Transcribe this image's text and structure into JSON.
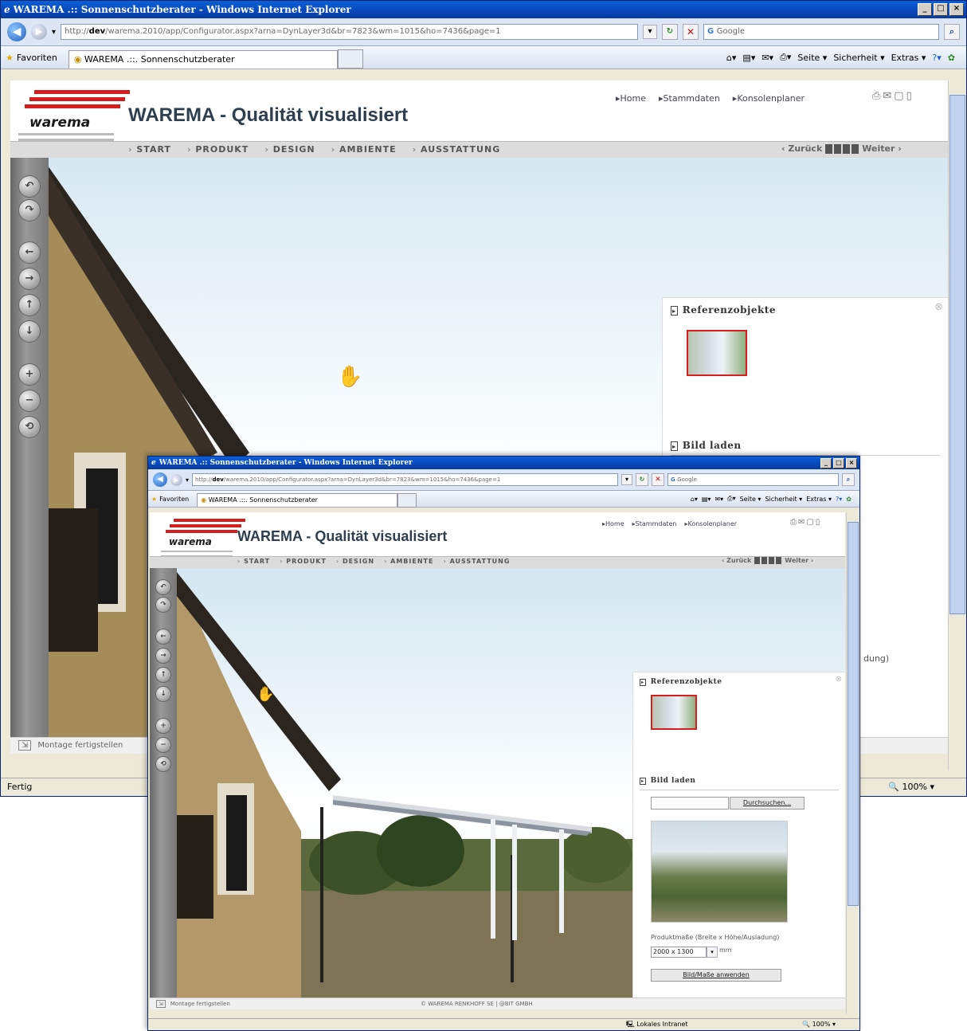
{
  "browser": {
    "title": "WAREMA .:: Sonnenschutzberater - Windows Internet Explorer",
    "url_prefix": "http://",
    "url_host": "dev",
    "url_rest": "/warema.2010/app/Configurator.aspx?arna=DynLayer3d&br=7823&wm=1015&ho=7436&page=1",
    "search_placeholder": "Google",
    "favorites_label": "Favoriten",
    "tab_label": "WAREMA .::. Sonnenschutzberater",
    "cmd_seite": "Seite ▾",
    "cmd_sicherheit": "Sicherheit ▾",
    "cmd_extras": "Extras ▾",
    "status_text": "Fertig",
    "status_zone": "Lokales Intranet",
    "zoom": "100%"
  },
  "site": {
    "logo_text": "warema",
    "page_title": "WAREMA - Qualität visualisiert",
    "top_links": [
      "Home",
      "Stammdaten",
      "Konsolenplaner"
    ],
    "nav": [
      "START",
      "PRODUKT",
      "DESIGN",
      "AMBIENTE",
      "AUSSTATTUNG"
    ],
    "back_label": "‹ Zurück",
    "next_label": "Weiter ›",
    "step_count": 4,
    "footer_left": "Montage fertigstellen",
    "footer_center": "© WAREMA RENKHOFF SE  |  @BIT GMBH"
  },
  "panel": {
    "ref_title": "Referenzobjekte",
    "upload_title": "Bild laden",
    "browse_label": "Durchsuchen...",
    "dimension_label": "Produktmaße (Breite x Höhe/Ausladung)",
    "dimension_value": "2000 x 1300",
    "unit": "mm",
    "apply_label": "Bild/Maße anwenden",
    "partial_text": "dung)"
  },
  "colors": {
    "titlebar": "#0a48b8",
    "brand_red": "#d51f1f"
  }
}
